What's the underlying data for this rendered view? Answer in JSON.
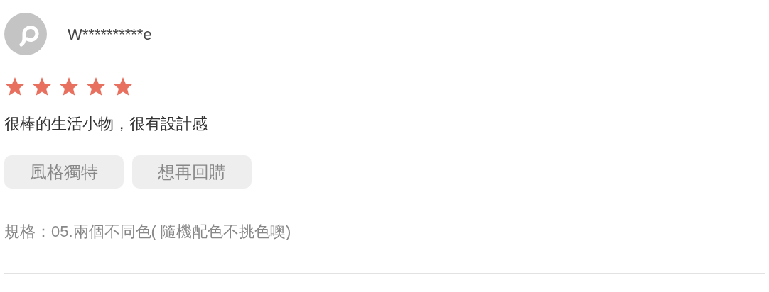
{
  "review": {
    "username": "W**********e",
    "stars": 5,
    "comment": "很棒的生活小物，很有設計感",
    "tags": [
      "風格獨特",
      "想再回購"
    ],
    "variant": "規格：05.兩個不同色( 隨機配色不挑色噢)"
  }
}
